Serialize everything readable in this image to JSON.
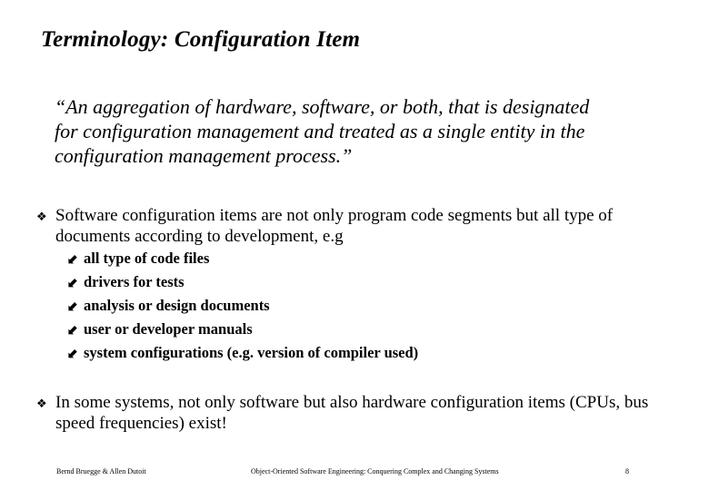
{
  "slide": {
    "title": "Terminology: Configuration Item",
    "quote_lines": [
      "“An aggregation of hardware, software, or both, that is designated",
      "for configuration management and treated as a single entity in the",
      "configuration management process.”"
    ],
    "bullet_icon": "four-diamond-bullet-icon",
    "bullets": [
      {
        "text": "Software configuration items are not only program code segments but all type of documents according to development, e.g",
        "sub_items_icon": "southwest-arrow-icon",
        "sub_items": [
          "all type of code files",
          "drivers for tests",
          "analysis or design documents",
          "user or developer manuals",
          "system configurations (e.g. version of compiler used)"
        ]
      },
      {
        "text": "In some systems, not only software but also hardware configuration items (CPUs, bus speed frequencies) exist!"
      }
    ]
  },
  "footer": {
    "authors": "Bernd Bruegge & Allen Dutoit",
    "book_title": "Object-Oriented Software Engineering: Conquering Complex and Changing Systems",
    "page_number": "8"
  },
  "glyphs": {
    "bullet": "❖",
    "sub_bullet": "⬋"
  }
}
